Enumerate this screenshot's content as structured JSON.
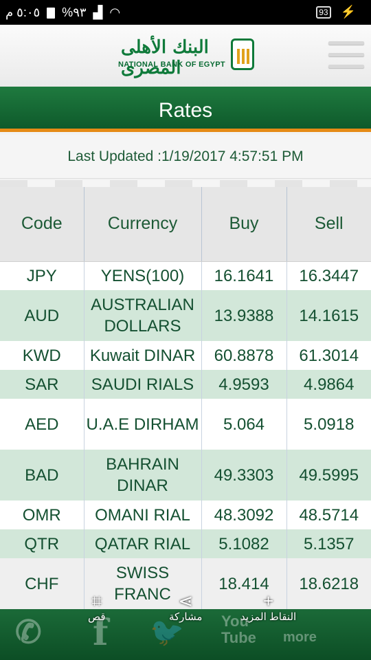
{
  "status_bar": {
    "time": "٥:٠٥ م",
    "battery_percent": "%٩٣",
    "battery_level": "93"
  },
  "header": {
    "logo_arabic": "البنك الأهلى المصرى",
    "logo_english": "NATIONAL BANK OF EGYPT"
  },
  "page": {
    "title": "Rates",
    "last_updated": "Last Updated :1/19/2017 4:57:51 PM"
  },
  "table": {
    "columns": [
      "Code",
      "Currency",
      "Buy",
      "Sell"
    ],
    "rows": [
      {
        "code": "JPY",
        "currency": "YENS(100)",
        "buy": "16.1641",
        "sell": "16.3447"
      },
      {
        "code": "AUD",
        "currency": "AUSTRALIAN DOLLARS",
        "buy": "13.9388",
        "sell": "14.1615"
      },
      {
        "code": "KWD",
        "currency": "Kuwait DINAR",
        "buy": "60.8878",
        "sell": "61.3014"
      },
      {
        "code": "SAR",
        "currency": "SAUDI RIALS",
        "buy": "4.9593",
        "sell": "4.9864"
      },
      {
        "code": "AED",
        "currency": "U.A.E DIRHAM",
        "buy": "5.064",
        "sell": "5.0918"
      },
      {
        "code": "BAD",
        "currency": "BAHRAIN DINAR",
        "buy": "49.3303",
        "sell": "49.5995"
      },
      {
        "code": "OMR",
        "currency": "OMANI RIAL",
        "buy": "48.3092",
        "sell": "48.5714"
      },
      {
        "code": "QTR",
        "currency": "QATAR RIAL",
        "buy": "5.1082",
        "sell": "5.1357"
      },
      {
        "code": "CHF",
        "currency": "SWISS FRANC",
        "buy": "18.414",
        "sell": "18.6218"
      }
    ]
  },
  "screenshot_actions": {
    "crop": "قص",
    "share": "مشاركة",
    "more": "النقاط المزيد"
  },
  "bottom_nav": {
    "youtube": "You Tube",
    "more": "more"
  },
  "colors": {
    "brand_green": "#0f7a3a",
    "accent_orange": "#e58b16",
    "row_green": "#d2e7d9",
    "text_green": "#145031"
  }
}
